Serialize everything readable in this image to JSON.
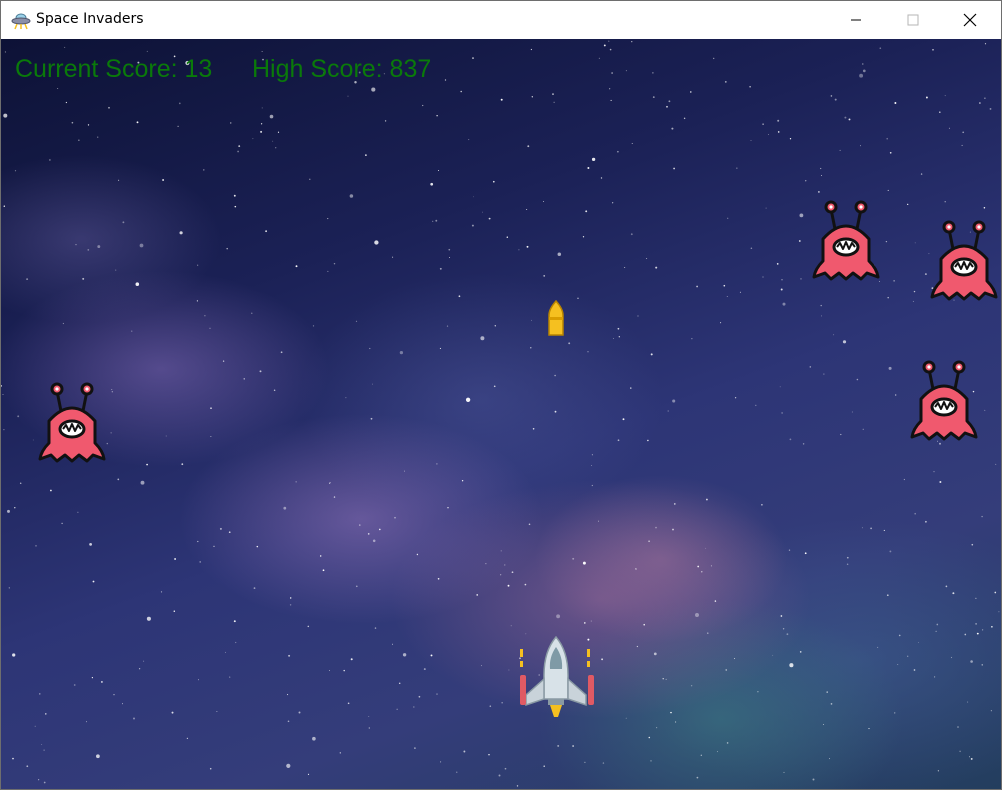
{
  "window": {
    "title": "Space Invaders",
    "app_icon": "ufo-icon",
    "controls": [
      "minimize-icon",
      "maximize-icon",
      "close-icon"
    ]
  },
  "hud": {
    "current_score_text": "Current Score: 13",
    "current_score": 13,
    "high_score_text": "High Score: 837",
    "high_score": 837,
    "text_color": "#0a7a0a"
  },
  "colors": {
    "alien_body": "#f0596e",
    "alien_outline": "#111111",
    "bullet": "#f5c020",
    "player_body": "#d8e2e8",
    "player_accent": "#e05a64"
  },
  "entities": {
    "aliens_visible": 4,
    "bullets_visible": 1,
    "player": "spaceship-icon"
  }
}
